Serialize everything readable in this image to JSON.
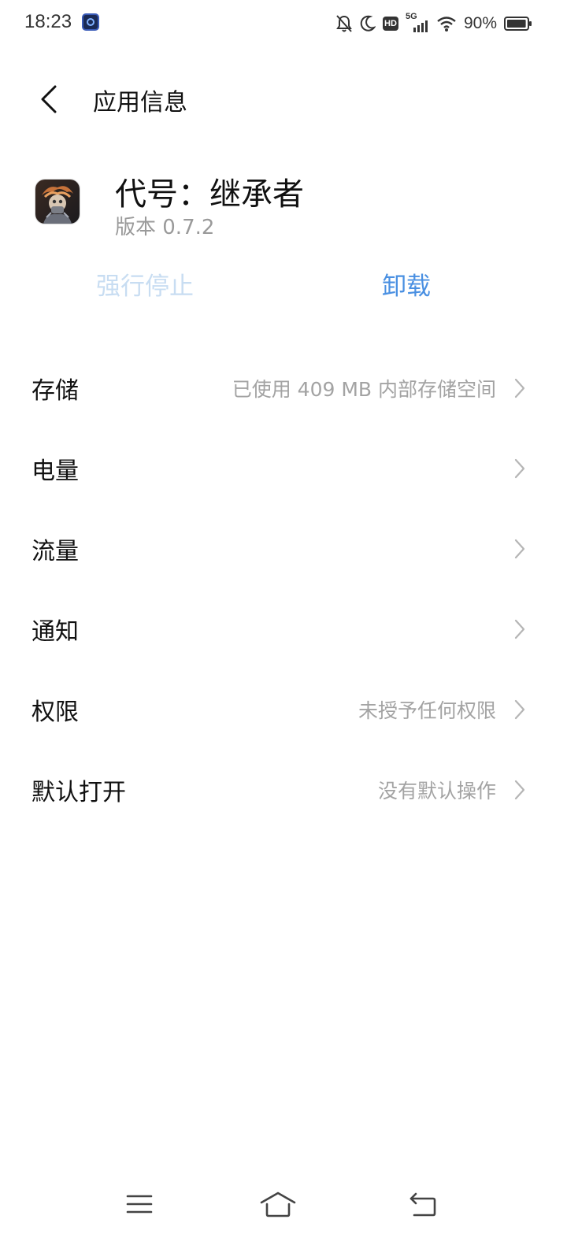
{
  "status_bar": {
    "time": "18:23",
    "network": "5G",
    "hd": "HD",
    "battery_percent": "90%",
    "battery_level": 0.9
  },
  "header": {
    "title": "应用信息",
    "back_icon": "chevron-left-icon"
  },
  "app": {
    "name": "代号：继承者",
    "version": "版本 0.7.2"
  },
  "actions": {
    "force_stop_label": "强行停止",
    "uninstall_label": "卸载",
    "force_stop_color": "#c8ddf2",
    "uninstall_color": "#4a90e2"
  },
  "settings": {
    "items": [
      {
        "label": "存储",
        "value": "已使用 409 MB 内部存储空间"
      },
      {
        "label": "电量",
        "value": ""
      },
      {
        "label": "流量",
        "value": ""
      },
      {
        "label": "通知",
        "value": ""
      },
      {
        "label": "权限",
        "value": "未授予任何权限"
      },
      {
        "label": "默认打开",
        "value": "没有默认操作"
      }
    ]
  },
  "nav_bar": {
    "menu_icon": "menu-icon",
    "home_icon": "home-icon",
    "back_icon": "back-icon"
  }
}
